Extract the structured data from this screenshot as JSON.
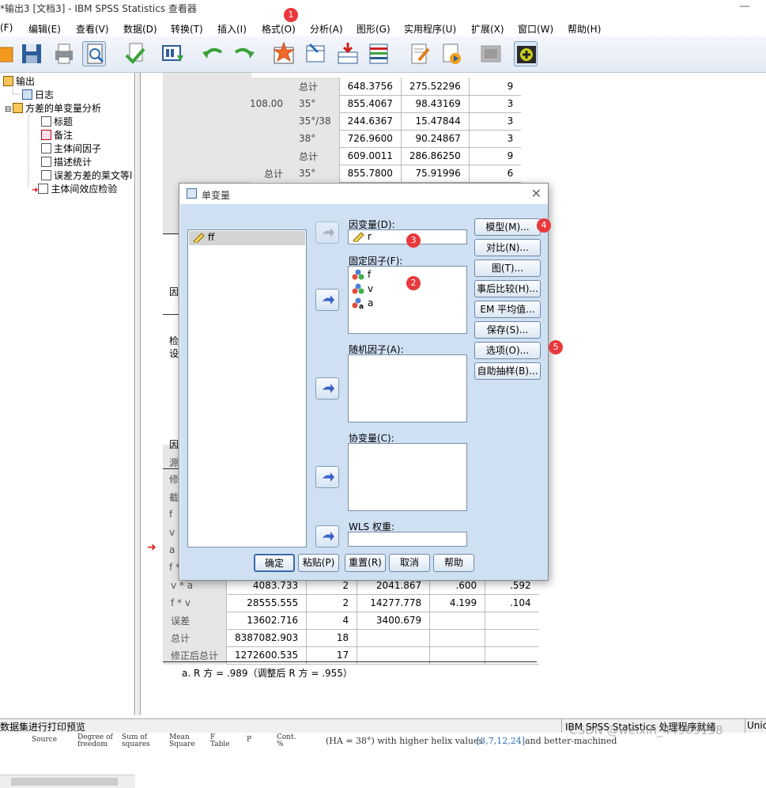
{
  "window": {
    "title": "*输出3 [文档3] - IBM SPSS Statistics 查看器"
  },
  "menu": [
    "(F)",
    "编辑(E)",
    "查看(V)",
    "数据(D)",
    "转换(T)",
    "插入(I)",
    "格式(O)",
    "分析(A)",
    "图形(G)",
    "实用程序(U)",
    "扩展(X)",
    "窗口(W)",
    "帮助(H)"
  ],
  "tree": {
    "root": "输出",
    "log": "日志",
    "anova": "方差的单变量分析",
    "items": [
      "标题",
      "备注",
      "主体间因子",
      "描述统计",
      "误差方差的莱文等l",
      "主体间效应检验"
    ]
  },
  "top_table": [
    {
      "g": "",
      "c": "总计",
      "m": "648.3756",
      "sd": "275.52296",
      "n": "9"
    },
    {
      "g": "108.00",
      "c": "35°",
      "m": "855.4067",
      "sd": "98.43169",
      "n": "3"
    },
    {
      "g": "",
      "c": "35°/38",
      "m": "244.6367",
      "sd": "15.47844",
      "n": "3"
    },
    {
      "g": "",
      "c": "38°",
      "m": "726.9600",
      "sd": "90.24867",
      "n": "3"
    },
    {
      "g": "",
      "c": "总计",
      "m": "609.0011",
      "sd": "286.86250",
      "n": "9"
    },
    {
      "g": "总计",
      "c": "35°",
      "m": "855.7800",
      "sd": "75.91996",
      "n": "6"
    }
  ],
  "left_fragments": [
    "因",
    "检",
    "设",
    "因",
    "源",
    "修",
    "截",
    "f",
    "v",
    "a",
    "f *"
  ],
  "bottom_table": [
    {
      "src": "v * a",
      "ss": "4083.733",
      "df": "2",
      "ms": "2041.867",
      "f": ".600",
      "sig": ".592"
    },
    {
      "src": "f * v",
      "ss": "28555.555",
      "df": "2",
      "ms": "14277.778",
      "f": "4.199",
      "sig": ".104"
    },
    {
      "src": "误差",
      "ss": "13602.716",
      "df": "4",
      "ms": "3400.679",
      "f": "",
      "sig": ""
    },
    {
      "src": "总计",
      "ss": "8387082.903",
      "df": "18",
      "ms": "",
      "f": "",
      "sig": ""
    },
    {
      "src": "修正后总计",
      "ss": "1272600.535",
      "df": "17",
      "ms": "",
      "f": "",
      "sig": ""
    }
  ],
  "footnote": "a. R 方 = .989（调整后 R 方 = .955）",
  "dialog": {
    "title": "单变量",
    "source_var": "ff",
    "dependent_label": "因变量(D):",
    "dependent_value": "r",
    "fixed_label": "固定因子(F):",
    "fixed_values": [
      "f",
      "v",
      "a"
    ],
    "random_label": "随机因子(A):",
    "covariate_label": "协变量(C):",
    "wls_label": "WLS 权重:",
    "right_buttons": [
      "模型(M)...",
      "对比(N)...",
      "图(T)...",
      "事后比较(H)...",
      "EM 平均值...",
      "保存(S)...",
      "选项(O)...",
      "自助抽样(B)..."
    ],
    "bottom_buttons": [
      "确定",
      "粘贴(P)",
      "重置(R)",
      "取消",
      "帮助"
    ]
  },
  "badges": [
    "1",
    "2",
    "3",
    "4",
    "5"
  ],
  "status": {
    "left": "数据集进行打印预览",
    "right": "IBM SPSS Statistics 处理程序就绪",
    "right2": "Unic"
  },
  "bottom_strip": [
    "Source",
    "Degree of freedom",
    "Sum of squares",
    "Mean Square",
    "F Table",
    "P",
    "Cont. %",
    "(HA = 38°) with higher helix values",
    "[3,7,12,24]",
    "and better-machined"
  ],
  "watermark": "CSDN @weixin_44909158",
  "colors": {
    "badge": "#e8393c",
    "dialog_bg": "#cfe0f3",
    "grey_cells": "#e6e6e6",
    "toolbar": "#e3eaf4"
  }
}
